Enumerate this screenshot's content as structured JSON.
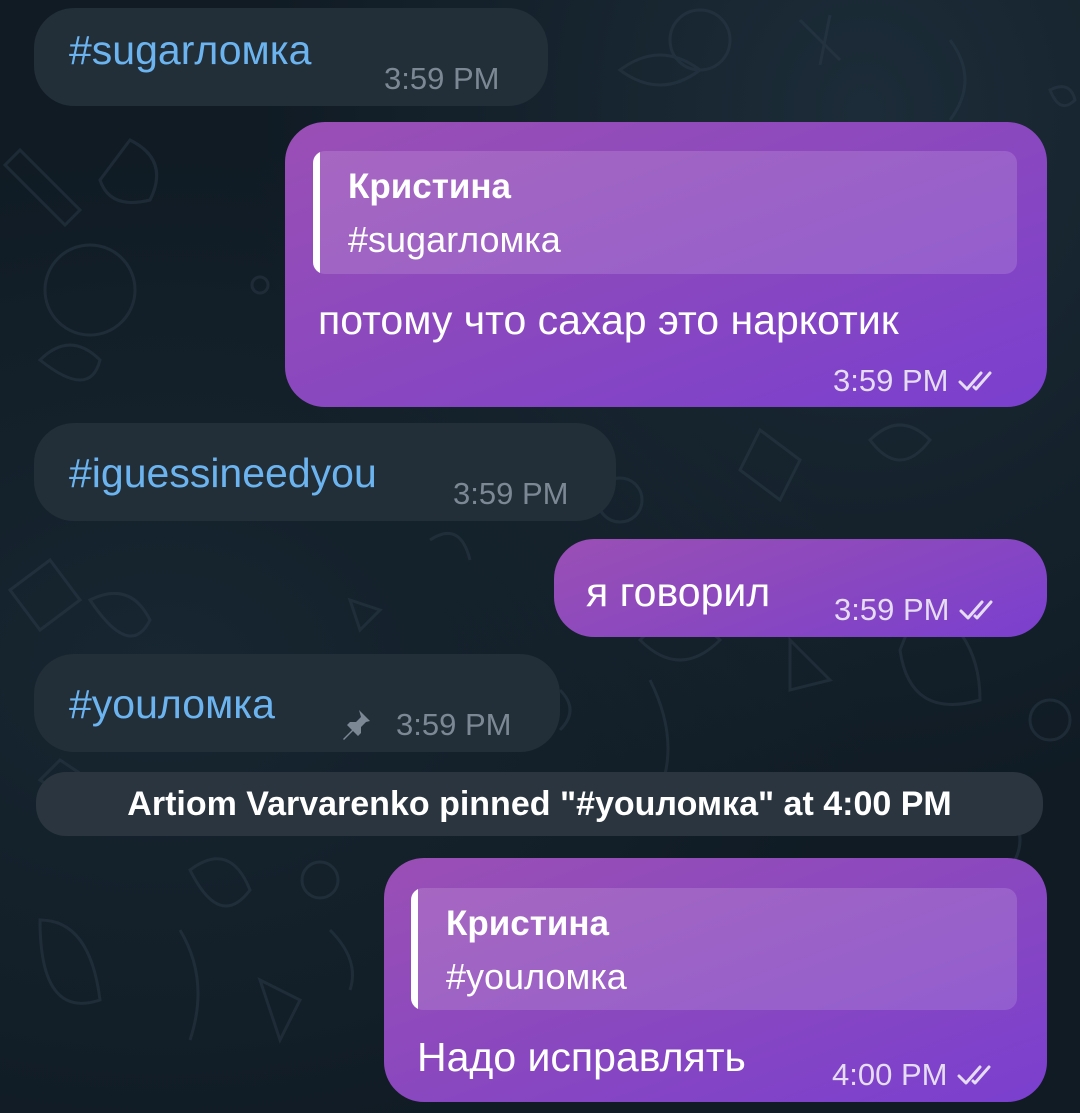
{
  "messages": [
    {
      "id": "m1",
      "direction": "incoming",
      "text": "#sugarломка",
      "time": "3:59 PM"
    },
    {
      "id": "m2",
      "direction": "outgoing",
      "reply": {
        "author": "Кристина",
        "text": "#sugarломка"
      },
      "text": "потому что сахар это наркотик",
      "time": "3:59 PM",
      "status": "read"
    },
    {
      "id": "m3",
      "direction": "incoming",
      "text": "#iguessineedyou",
      "time": "3:59 PM"
    },
    {
      "id": "m4",
      "direction": "outgoing",
      "text": "я говорил",
      "time": "3:59 PM",
      "status": "read"
    },
    {
      "id": "m5",
      "direction": "incoming",
      "text": "#youломка",
      "time": "3:59 PM",
      "pinned": true
    },
    {
      "id": "m7",
      "direction": "outgoing",
      "reply": {
        "author": "Кристина",
        "text": "#youломка"
      },
      "text": "Надо исправлять",
      "time": "4:00 PM",
      "status": "read"
    }
  ],
  "service_message": "Artiom Varvarenko pinned \"#youломка\" at 4:00 PM",
  "icons": {
    "pin": "pin-icon",
    "read": "double-check-icon"
  },
  "colors": {
    "background": "#101b24",
    "incoming_bubble": "#222e38",
    "hashtag": "#6cb4ef",
    "outgoing_bubble_start": "#9a4fb5",
    "outgoing_bubble_end": "#7a3fcf",
    "service_bubble": "#2a353f"
  }
}
